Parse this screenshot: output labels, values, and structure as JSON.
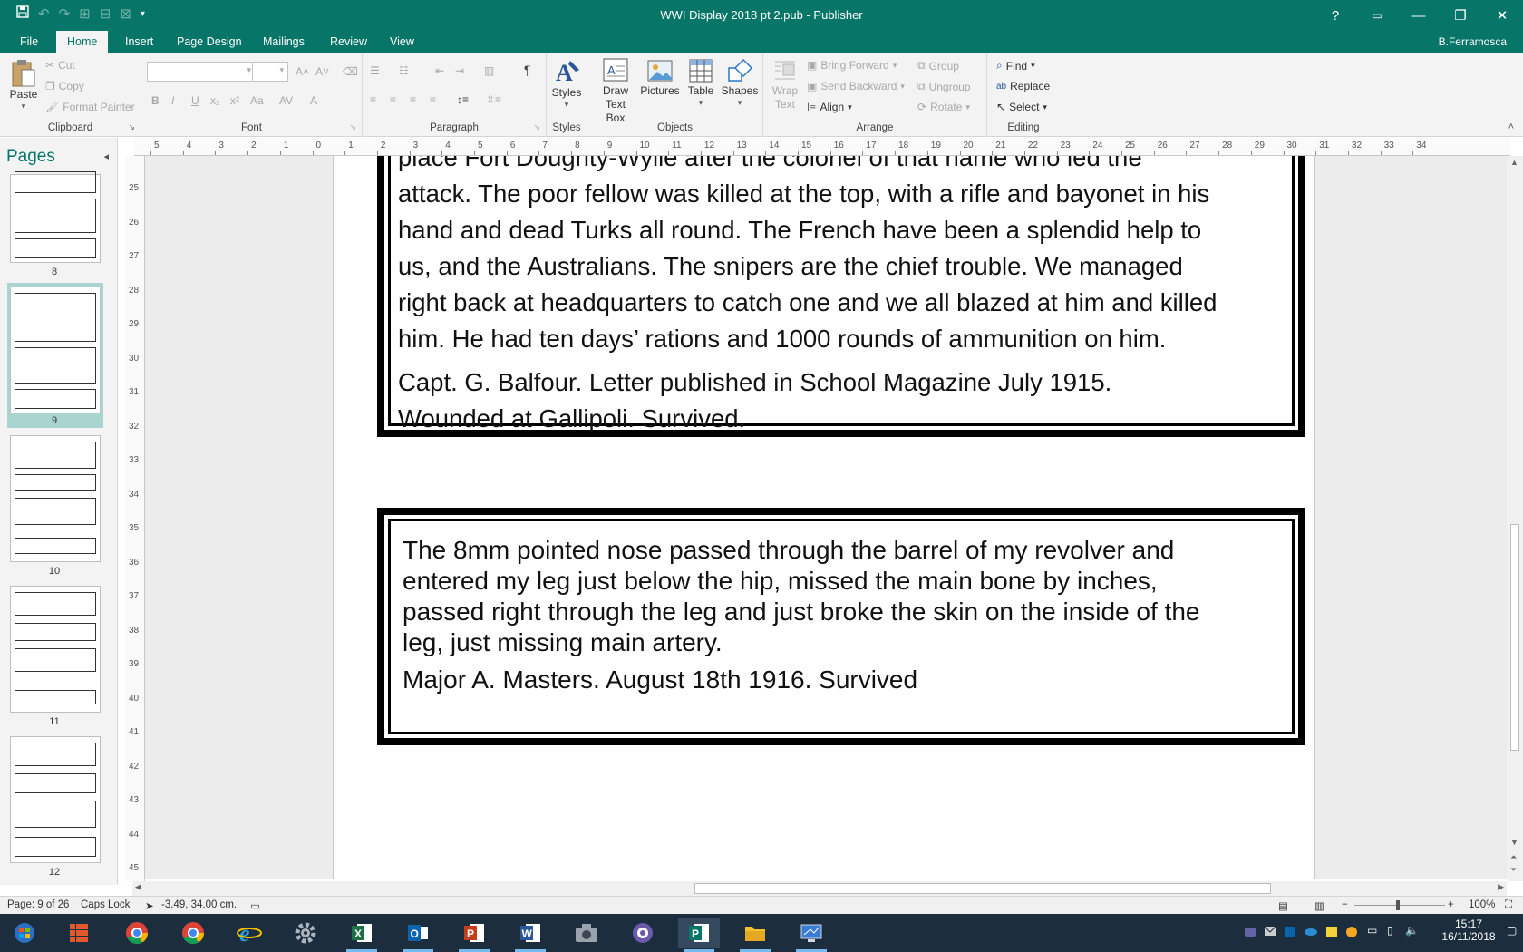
{
  "window": {
    "title": "WWI Display 2018 pt 2.pub - Publisher",
    "user": "B.Ferramosca",
    "controls": {
      "help": "?",
      "minimize": "—",
      "restore": "❐",
      "close": "✕"
    }
  },
  "ribbon_tabs": [
    "File",
    "Home",
    "Insert",
    "Page Design",
    "Mailings",
    "Review",
    "View"
  ],
  "ribbon": {
    "clipboard": {
      "label": "Clipboard",
      "paste": "Paste",
      "cut": "Cut",
      "copy": "Copy",
      "format_painter": "Format Painter"
    },
    "font": {
      "label": "Font",
      "buttons": [
        "B",
        "I",
        "U",
        "x₂",
        "x²",
        "Aa",
        "AV",
        "A"
      ]
    },
    "paragraph": {
      "label": "Paragraph"
    },
    "styles": {
      "label": "Styles",
      "button": "Styles"
    },
    "objects": {
      "label": "Objects",
      "draw_text_box": [
        "Draw",
        "Text Box"
      ],
      "pictures": "Pictures",
      "table": "Table",
      "shapes": "Shapes"
    },
    "arrange": {
      "label": "Arrange",
      "wrap_text": [
        "Wrap",
        "Text"
      ],
      "bring_forward": "Bring Forward",
      "send_backward": "Send Backward",
      "align": "Align",
      "group": "Group",
      "ungroup": "Ungroup",
      "rotate": "Rotate"
    },
    "editing": {
      "label": "Editing",
      "find": "Find",
      "replace": "Replace",
      "select": "Select"
    }
  },
  "pages_pane": {
    "title": "Pages",
    "pages": [
      {
        "number": "8",
        "selected": false
      },
      {
        "number": "9",
        "selected": true
      },
      {
        "number": "10",
        "selected": false
      },
      {
        "number": "11",
        "selected": false
      },
      {
        "number": "12",
        "selected": false
      }
    ]
  },
  "rulers": {
    "horizontal": [
      "5",
      "4",
      "3",
      "2",
      "1",
      "0",
      "1",
      "2",
      "3",
      "4",
      "5",
      "6",
      "7",
      "8",
      "9",
      "10",
      "11",
      "12",
      "13",
      "14",
      "15",
      "16",
      "17",
      "18",
      "19",
      "20",
      "21",
      "22",
      "23",
      "24",
      "25",
      "26",
      "27",
      "28",
      "29",
      "30",
      "31",
      "32",
      "33",
      "34"
    ],
    "vertical": [
      "25",
      "26",
      "27",
      "28",
      "29",
      "30",
      "31",
      "32",
      "33",
      "34",
      "35",
      "36",
      "37",
      "38",
      "39",
      "40",
      "41",
      "42",
      "43",
      "44",
      "45"
    ]
  },
  "document": {
    "quote1": {
      "lines": [
        "place Fort Doughty-Wylie after the colonel of that name who led the",
        "attack. The poor fellow was killed at the top, with a rifle and bayonet in his",
        "hand and dead Turks all round. The French have been a splendid help to",
        "us, and the Australians. The snipers are the chief trouble. We managed",
        "right back at headquarters to catch one and we all blazed at him and killed",
        "him. He had ten days’ rations and 1000 rounds of ammunition on him."
      ],
      "attribution": [
        "Capt. G. Balfour. Letter published in School Magazine July 1915.",
        "Wounded at Gallipoli. Survived."
      ]
    },
    "quote2": {
      "lines": [
        "The 8mm pointed nose passed through the barrel of my revolver and",
        "entered my leg just below the hip, missed the main bone by inches,",
        "passed right through the leg and just broke the skin on the inside of the",
        "leg, just missing main artery."
      ],
      "attribution": "Major A. Masters. August 18th 1916. Survived"
    }
  },
  "status": {
    "page": "Page: 9 of 26",
    "caps_lock": "Caps Lock",
    "cursor_position": "-3.49, 34.00 cm.",
    "zoom": "100%"
  },
  "taskbar": {
    "time": "15:17",
    "date": "16/11/2018",
    "apps": [
      "start-icon",
      "apps-grid-icon",
      "chrome-icon",
      "chrome-icon",
      "internet-explorer-icon",
      "settings-icon",
      "excel-icon",
      "outlook-icon",
      "powerpoint-icon",
      "word-icon",
      "camera-icon",
      "media-icon",
      "publisher-icon",
      "file-explorer-icon",
      "remote-desktop-icon"
    ]
  },
  "colors": {
    "accent": "#077568",
    "taskbar": "#1c2d3e"
  }
}
